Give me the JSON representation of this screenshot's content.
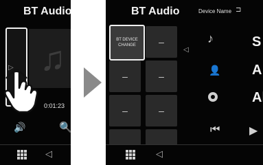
{
  "left_screen": {
    "title": "BT Audio",
    "time": "0:01:23"
  },
  "right_screen": {
    "title": "BT Audio",
    "device_name_label": "Device Name",
    "device_change_label_line1": "BT DEVICE",
    "device_change_label_line2": "CHANGE",
    "grid_buttons": [
      "–",
      "–",
      "–",
      "–",
      "–",
      "–",
      "–"
    ],
    "track_info": {
      "title_initial": "S",
      "artist_initial": "A",
      "album_initial": "Al"
    }
  },
  "icons": {
    "sidebar_arrow": "▷",
    "grid_back_arrow": "◁",
    "back_arrow": "◁",
    "speaker": "🔊",
    "search": "🔍",
    "note": "♪",
    "person": "👤",
    "prev": "⏮",
    "play": "▶"
  }
}
